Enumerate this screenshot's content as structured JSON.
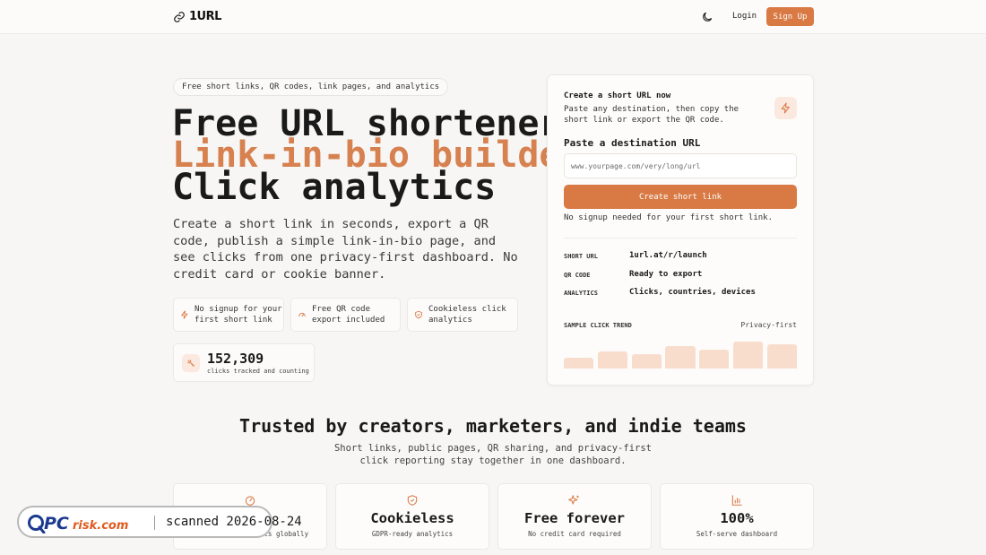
{
  "header": {
    "brand": "1URL",
    "login_label": "Login",
    "signup_label": "Sign Up",
    "icons": [
      "link-icon",
      "moon-icon"
    ]
  },
  "hero": {
    "pill": "Free short links, QR codes, link pages, and analytics",
    "title_line1": "Free URL shortener",
    "title_line2": "Link-in-bio builder",
    "title_line3": "Click analytics",
    "lead": "Create a short link in seconds, export a QR code, publish a simple link-in-bio page, and see clicks from one privacy-first dashboard. No credit card or cookie banner.",
    "features": [
      {
        "label": "No signup for your first short link",
        "icon": "bolt-icon"
      },
      {
        "label": "Free QR code export included",
        "icon": "gauge-icon"
      },
      {
        "label": "Cookieless click analytics",
        "icon": "shield-icon"
      }
    ],
    "stat": {
      "value": "152,309",
      "label": "clicks tracked and counting",
      "icon": "sparkle-icon"
    }
  },
  "card": {
    "title": "Create a short URL now",
    "description": "Paste any destination, then copy the short link or export the QR code.",
    "input_label": "Paste a destination URL",
    "input_placeholder": "www.yourpage.com/very/long/url",
    "button_label": "Create short link",
    "note": "No signup needed for your first short link.",
    "rows": [
      {
        "key": "SHORT URL",
        "value": "1url.at/r/launch"
      },
      {
        "key": "QR CODE",
        "value": "Ready to export"
      },
      {
        "key": "ANALYTICS",
        "value": "Clicks, countries, devices"
      }
    ],
    "trend_label": "SAMPLE CLICK TREND",
    "trend_tag": "Privacy-first",
    "trend_values": [
      12,
      19,
      16,
      25,
      21,
      30,
      27
    ],
    "accent": "#d97a45",
    "bar_color": "#f8ddcd"
  },
  "trusted": {
    "heading": "Trusted by creators, marketers, and indie teams",
    "subheading": "Short links, public pages, QR sharing, and privacy-first click reporting stay together in one dashboard.",
    "tiles": [
      {
        "icon": "gauge-icon",
        "value": "",
        "label": "cts globally"
      },
      {
        "icon": "shield-icon",
        "value": "Cookieless",
        "label": "GDPR-ready analytics"
      },
      {
        "icon": "sparkle-icon",
        "value": "Free forever",
        "label": "No credit card required"
      },
      {
        "icon": "bar-chart-icon",
        "value": "100%",
        "label": "Self-serve dashboard"
      }
    ]
  },
  "watermark": {
    "brand": "PCrisk.com",
    "text": "scanned 2026-08-24"
  }
}
